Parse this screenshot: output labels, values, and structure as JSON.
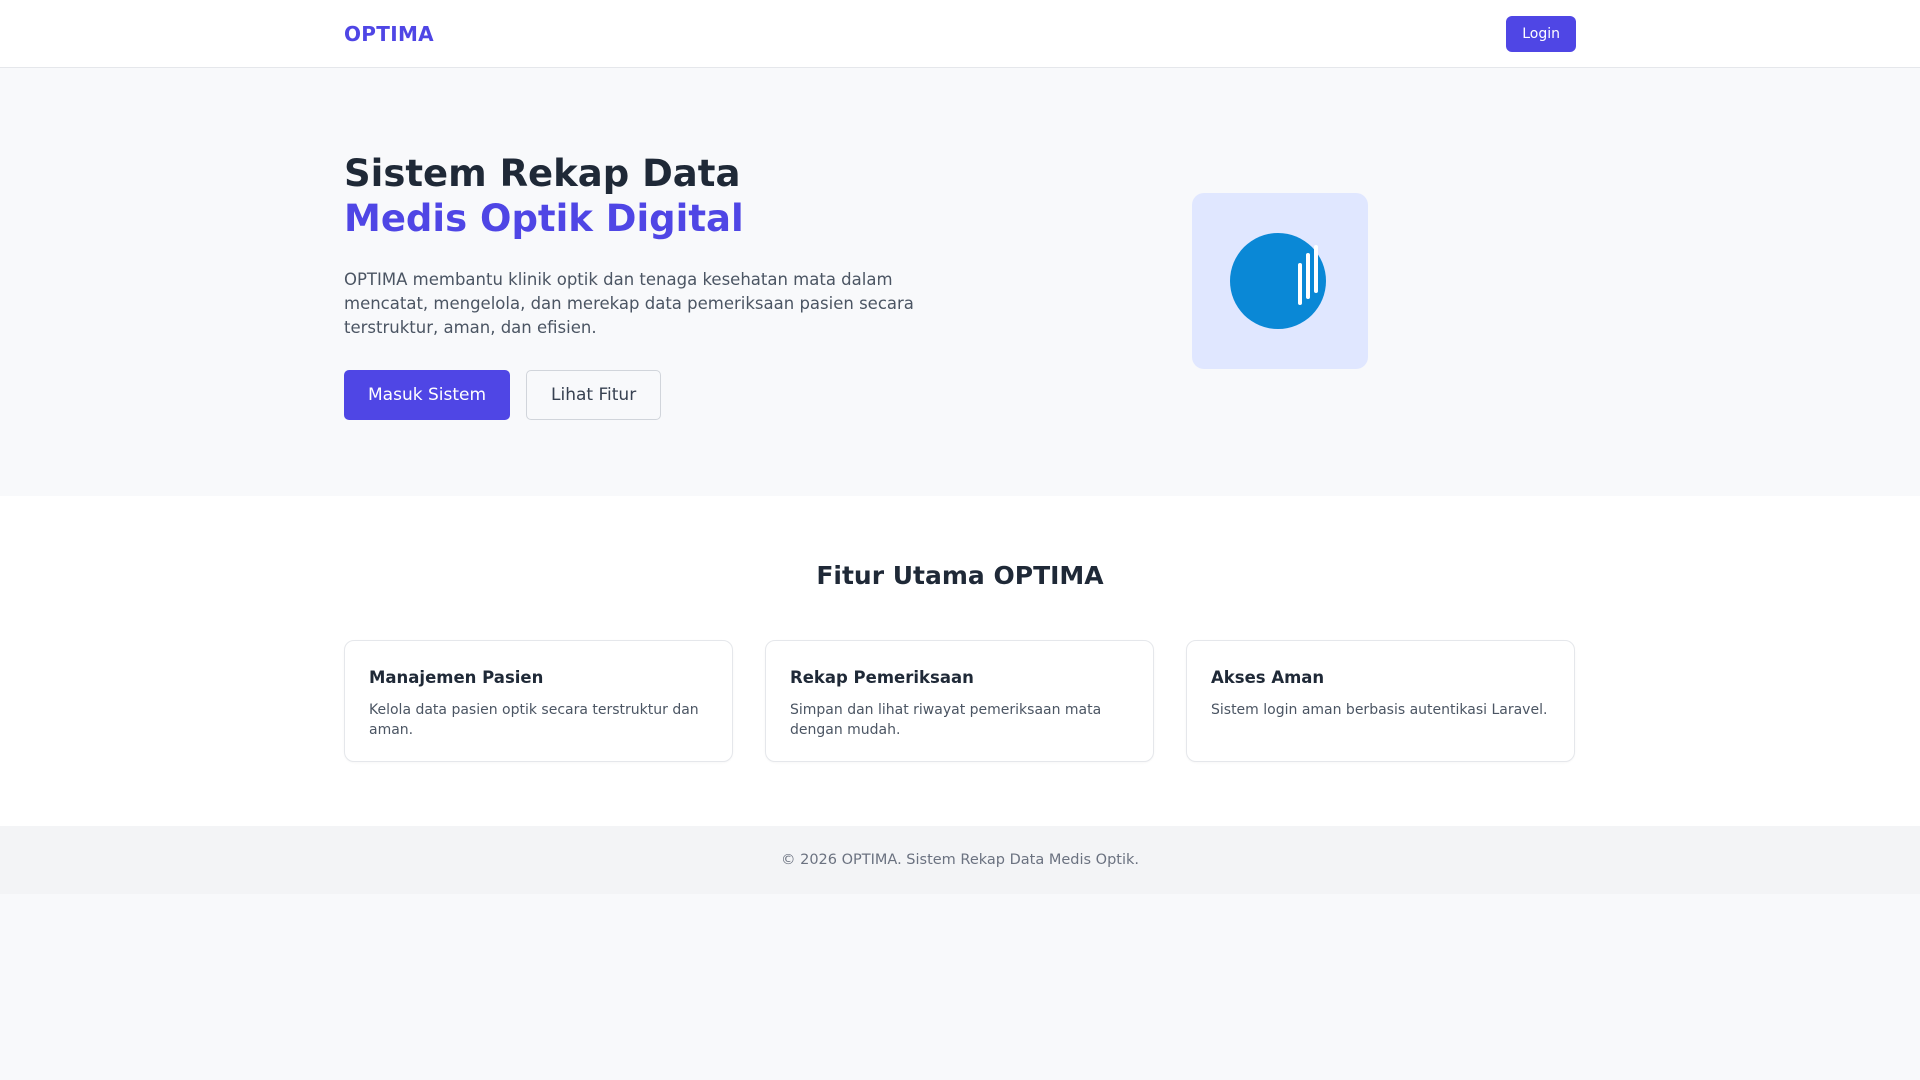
{
  "navbar": {
    "brand": "OPTIMA",
    "login_label": "Login"
  },
  "hero": {
    "title_line1": "Sistem Rekap Data",
    "title_line2": "Medis Optik Digital",
    "description": "OPTIMA membantu klinik optik dan tenaga kesehatan mata dalam mencatat, mengelola, dan merekap data pemeriksaan pasien secara terstruktur, aman, dan efisien.",
    "primary_button": "Masuk Sistem",
    "secondary_button": "Lihat Fitur",
    "logo_icon": "optima-logo-icon"
  },
  "features": {
    "title": "Fitur Utama OPTIMA",
    "cards": [
      {
        "title": "Manajemen Pasien",
        "description": "Kelola data pasien optik secara terstruktur dan aman."
      },
      {
        "title": "Rekap Pemeriksaan",
        "description": "Simpan dan lihat riwayat pemeriksaan mata dengan mudah."
      },
      {
        "title": "Akses Aman",
        "description": "Sistem login aman berbasis autentikasi Laravel."
      }
    ]
  },
  "footer": {
    "text": "© 2026 OPTIMA. Sistem Rekap Data Medis Optik."
  },
  "colors": {
    "accent": "#4f46e5",
    "logo_blue": "#0a88d6",
    "logo_bg": "#e0e7ff"
  }
}
